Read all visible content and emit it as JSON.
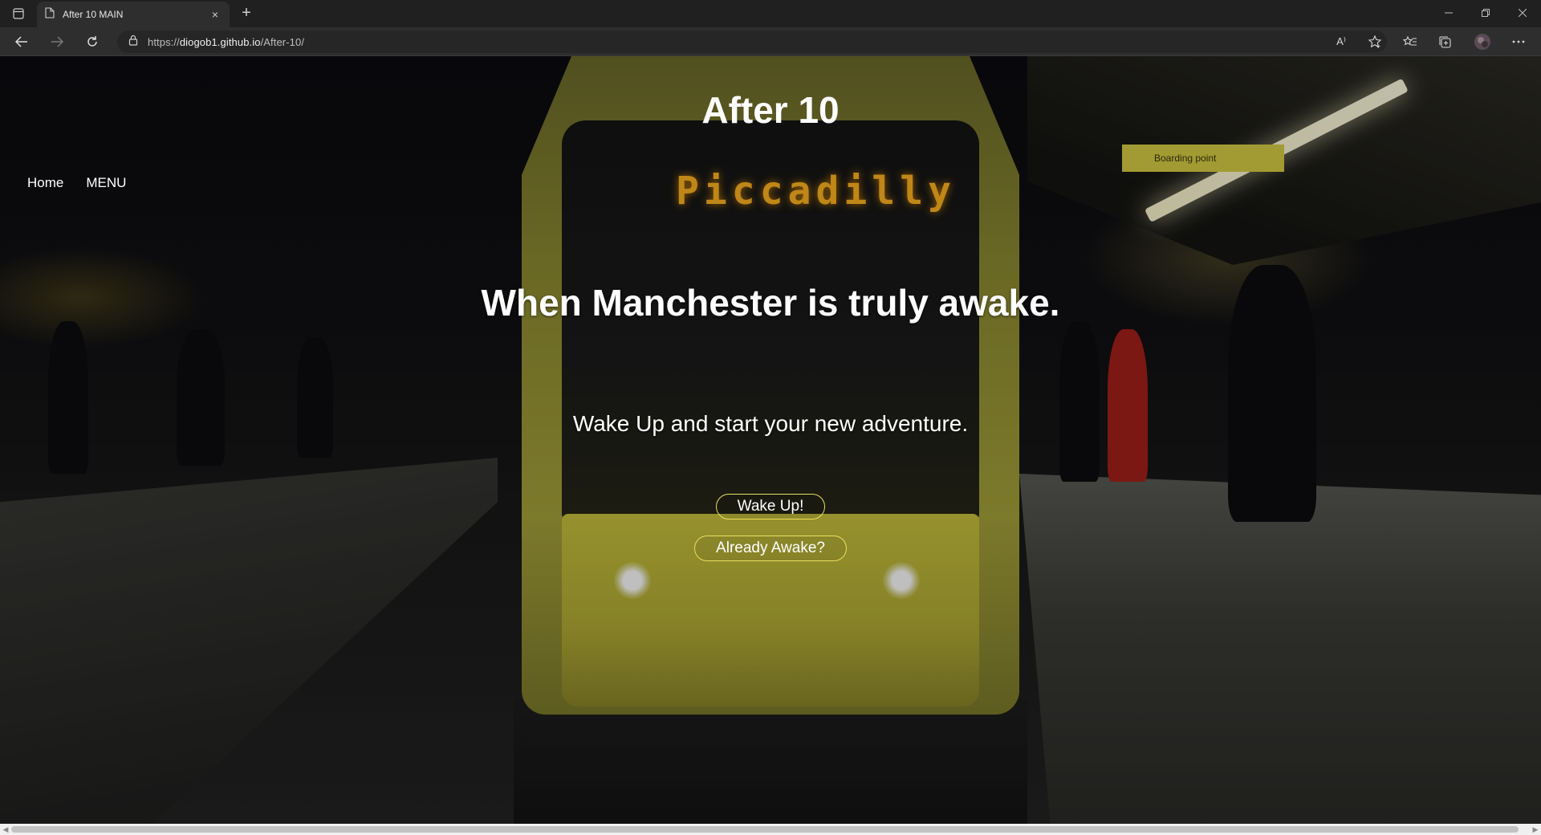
{
  "browser": {
    "tab_title": "After 10 MAIN",
    "tab_close": "×",
    "new_tab": "+",
    "address": {
      "scheme": "https://",
      "host": "diogob1.github.io",
      "path": "/After-10/"
    },
    "read_aloud": "A⁾"
  },
  "site": {
    "title": "After 10",
    "nav": {
      "home": "Home",
      "menu": "MENU"
    }
  },
  "hero": {
    "heading": "When Manchester is truly awake.",
    "subheading": "Wake Up and start your new adventure.",
    "buttons": {
      "wake_up": "Wake Up!",
      "already_awake": "Already Awake?"
    }
  },
  "background": {
    "tram_sign": "Piccadilly",
    "platform_sign": "Boarding point"
  },
  "colors": {
    "accent_border": "#e8e060",
    "tram_yellow": "#c9c33e",
    "sign_amber": "#ffb520"
  }
}
